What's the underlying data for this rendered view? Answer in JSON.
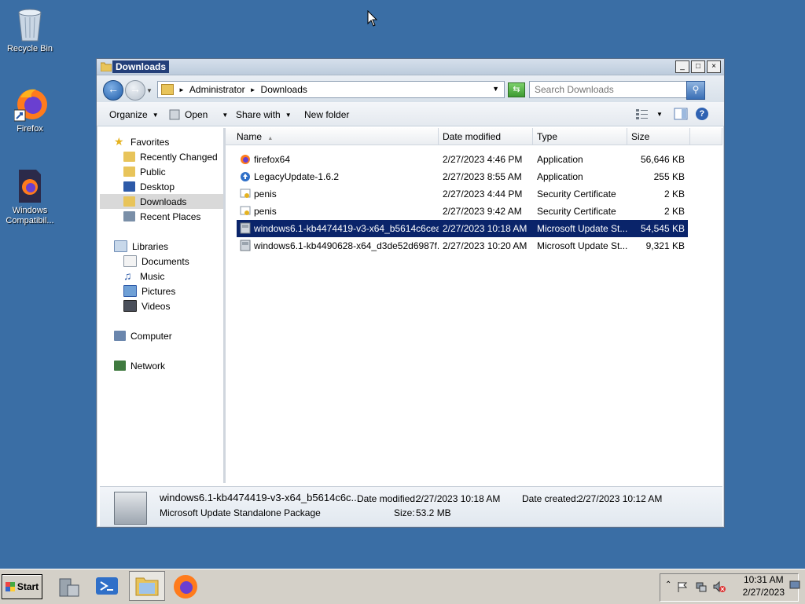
{
  "desktop": {
    "icons": [
      {
        "label": "Recycle Bin",
        "icon": "recycle-bin-icon"
      },
      {
        "label": "Firefox",
        "icon": "firefox-icon"
      },
      {
        "label": "Windows Compatibil...",
        "icon": "windows-compat-icon"
      }
    ]
  },
  "window": {
    "title": "Downloads",
    "controls": {
      "minimize": "_",
      "maximize": "□",
      "close": "×"
    }
  },
  "address": {
    "breadcrumbs": [
      "Administrator",
      "Downloads"
    ],
    "search_placeholder": "Search Downloads"
  },
  "toolbar": {
    "organize": "Organize",
    "open": "Open",
    "share_with": "Share with",
    "new_folder": "New folder",
    "help": "?"
  },
  "nav": {
    "favorites": {
      "label": "Favorites",
      "items": [
        "Recently Changed",
        "Public",
        "Desktop",
        "Downloads",
        "Recent Places"
      ],
      "selected": "Downloads"
    },
    "libraries": {
      "label": "Libraries",
      "items": [
        "Documents",
        "Music",
        "Pictures",
        "Videos"
      ]
    },
    "computer": "Computer",
    "network": "Network"
  },
  "files": {
    "columns": [
      "Name",
      "Date modified",
      "Type",
      "Size"
    ],
    "rows": [
      {
        "name": "firefox64",
        "date": "2/27/2023 4:46 PM",
        "type": "Application",
        "size": "56,646 KB",
        "icon": "firefox-app-icon"
      },
      {
        "name": "LegacyUpdate-1.6.2",
        "date": "2/27/2023 8:55 AM",
        "type": "Application",
        "size": "255 KB",
        "icon": "legacy-update-icon"
      },
      {
        "name": "penis",
        "date": "2/27/2023 4:44 PM",
        "type": "Security Certificate",
        "size": "2 KB",
        "icon": "certificate-icon"
      },
      {
        "name": "penis",
        "date": "2/27/2023 9:42 AM",
        "type": "Security Certificate",
        "size": "2 KB",
        "icon": "certificate-icon"
      },
      {
        "name": "windows6.1-kb4474419-v3-x64_b5614c6cea...",
        "date": "2/27/2023 10:18 AM",
        "type": "Microsoft Update St...",
        "size": "54,545 KB",
        "icon": "msu-package-icon",
        "selected": true
      },
      {
        "name": "windows6.1-kb4490628-x64_d3de52d6987f...",
        "date": "2/27/2023 10:20 AM",
        "type": "Microsoft Update St...",
        "size": "9,321 KB",
        "icon": "msu-package-icon"
      }
    ]
  },
  "details": {
    "name": "windows6.1-kb4474419-v3-x64_b5614c6c...",
    "type": "Microsoft Update Standalone Package",
    "modified_label": "Date modified:",
    "modified_value": "2/27/2023 10:18 AM",
    "created_label": "Date created:",
    "created_value": "2/27/2023 10:12 AM",
    "size_label": "Size:",
    "size_value": "53.2 MB"
  },
  "taskbar": {
    "start": "Start",
    "time": "10:31 AM",
    "date": "2/27/2023"
  }
}
